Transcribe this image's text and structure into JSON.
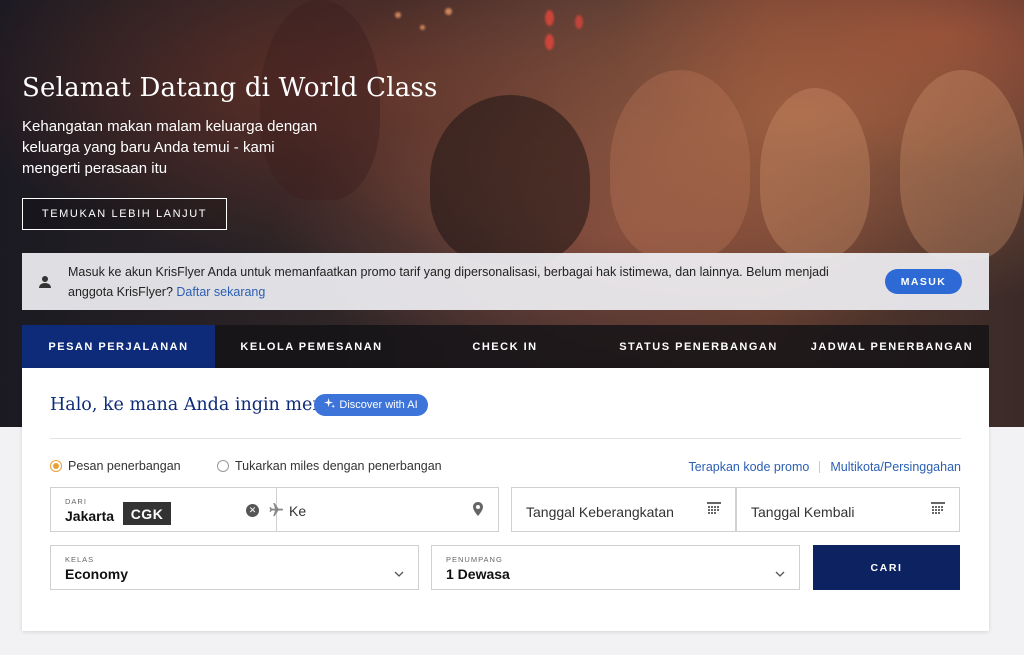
{
  "hero": {
    "title": "Selamat Datang di World Class",
    "subtitle": "Kehangatan makan malam keluarga dengan keluarga yang baru Anda temui - kami mengerti perasaan itu",
    "cta_label": "TEMUKAN LEBIH LANJUT"
  },
  "login_banner": {
    "text": "Masuk ke akun KrisFlyer Anda untuk memanfaatkan promo tarif yang dipersonalisasi, berbagai hak istimewa, dan lainnya. Belum menjadi anggota KrisFlyer?",
    "link_label": "Daftar sekarang",
    "button_label": "MASUK",
    "icon": "user-icon"
  },
  "tabs": [
    {
      "label": "PESAN PERJALANAN",
      "active": true
    },
    {
      "label": "KELOLA PEMESANAN",
      "active": false
    },
    {
      "label": "CHECK IN",
      "active": false
    },
    {
      "label": "STATUS PENERBANGAN",
      "active": false
    },
    {
      "label": "JADWAL PENERBANGAN",
      "active": false
    }
  ],
  "booking": {
    "greeting": "Halo, ke mana Anda ingin menuju?",
    "ai_button_label": "Discover with AI",
    "radio_options": [
      {
        "label": "Pesan penerbangan",
        "checked": true
      },
      {
        "label": "Tukarkan miles dengan penerbangan",
        "checked": false
      }
    ],
    "links": {
      "promo": "Terapkan kode promo",
      "multicity": "Multikota/Persinggahan"
    },
    "from": {
      "label": "DARI",
      "city": "Jakarta",
      "code": "CGK"
    },
    "to": {
      "placeholder": "Ke"
    },
    "departure_date": {
      "placeholder": "Tanggal Keberangkatan"
    },
    "return_date": {
      "placeholder": "Tanggal Kembali"
    },
    "class": {
      "label": "KELAS",
      "value": "Economy"
    },
    "passengers": {
      "label": "PENUMPANG",
      "value": "1 Dewasa"
    },
    "search_label": "CARI"
  },
  "colors": {
    "brand_navy": "#0d2b78",
    "search_button": "#0d2261",
    "accent_blue": "#2d6ad6",
    "radio_checked": "#e8a038"
  }
}
